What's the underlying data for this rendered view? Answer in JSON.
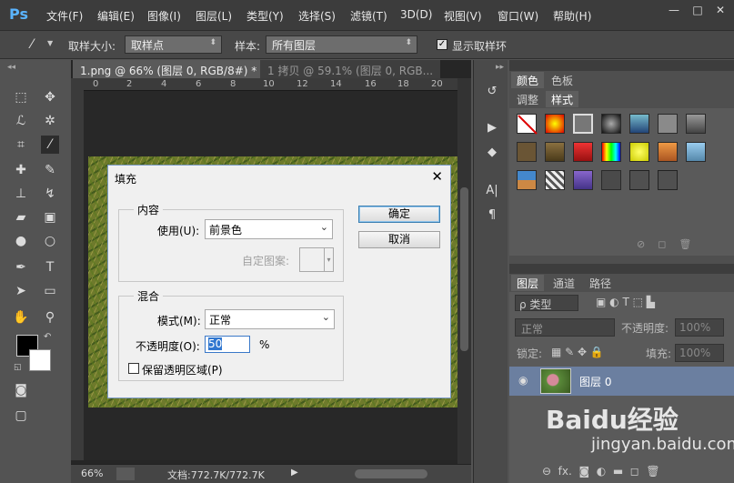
{
  "app": {
    "logo": "Ps"
  },
  "menu": [
    "文件(F)",
    "编辑(E)",
    "图像(I)",
    "图层(L)",
    "类型(Y)",
    "选择(S)",
    "滤镜(T)",
    "3D(D)",
    "视图(V)",
    "窗口(W)",
    "帮助(H)"
  ],
  "window_controls": {
    "minimize": "—",
    "restore": "□",
    "close": "✕"
  },
  "options": {
    "sample_size_label": "取样大小:",
    "sample_size_value": "取样点",
    "sample_label": "样本:",
    "sample_value": "所有图层",
    "show_ring_label": "显示取样环"
  },
  "tabs": [
    {
      "label": "1.png @ 66% (图层 0, RGB/8#) * ✕"
    },
    {
      "label": "1 拷贝 @ 59.1% (图层 0, RGB..."
    }
  ],
  "ruler_ticks": [
    "0",
    "2",
    "4",
    "6",
    "8",
    "10",
    "12",
    "14",
    "16",
    "18",
    "20"
  ],
  "status": {
    "zoom": "66%",
    "doc": "文档:772.7K/772.7K"
  },
  "colors_panel": {
    "tabs": [
      "颜色",
      "色板"
    ]
  },
  "styles_panel": {
    "tabs": [
      "调整",
      "样式"
    ]
  },
  "layers_panel": {
    "tabs": [
      "图层",
      "通道",
      "路径"
    ],
    "filter_label": "ρ 类型",
    "blend_mode": "正常",
    "opacity_label": "不透明度:",
    "opacity_value": "100%",
    "lock_label": "锁定:",
    "fill_label": "填充:",
    "fill_value": "100%",
    "layer_name": "图层 0"
  },
  "dialog": {
    "title": "填充",
    "close": "✕",
    "content_group": "内容",
    "use_label": "使用(U):",
    "use_value": "前景色",
    "custom_pattern_label": "自定图案:",
    "blend_group": "混合",
    "mode_label": "模式(M):",
    "mode_value": "正常",
    "opacity_label": "不透明度(O):",
    "opacity_value": "50",
    "opacity_unit": "%",
    "preserve_label": "保留透明区域(P)",
    "ok_label": "确定",
    "cancel_label": "取消"
  },
  "watermark": {
    "brand": "Baidu经验",
    "url": "jingyan.baidu.com"
  },
  "colors": {
    "accent": "#5ab4ff",
    "dialog_border": "#7a9ac6",
    "selected_layer": "#6b7fa0"
  }
}
